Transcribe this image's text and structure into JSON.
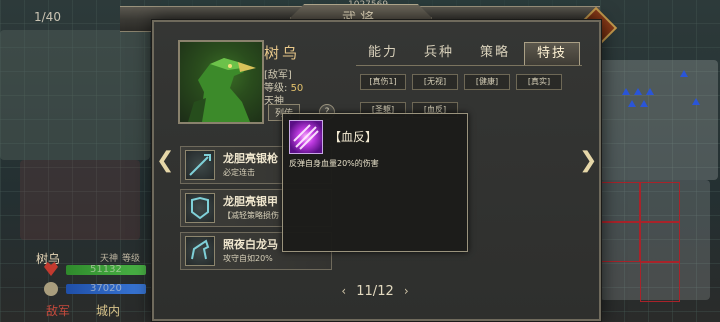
{
  "hud": {
    "page_counter": "1/40",
    "top_number": "1027569"
  },
  "map_general": {
    "name": "树乌",
    "type": "天神",
    "level_label": "等级",
    "hp_value": "51132",
    "hp_max": "/",
    "mp_value": "37020",
    "mp_max": "/",
    "faction": "敌军",
    "location": "城内"
  },
  "dialog": {
    "title": "武将",
    "close_label": "✕",
    "general": {
      "name": "树乌",
      "faction": "[敌军]",
      "level_label": "等级:",
      "level_value": "50",
      "type": "天神",
      "badge": "列传",
      "help": "?"
    },
    "tabs": [
      {
        "label": "能力"
      },
      {
        "label": "兵种"
      },
      {
        "label": "策略"
      },
      {
        "label": "特技"
      }
    ],
    "active_tab": "特技",
    "skills_row1": [
      "[真伤1]",
      "[无视]",
      "[健康]",
      "[真实]"
    ],
    "skills_row2": [
      "[圣躯]",
      "[血反]"
    ],
    "equipment": [
      {
        "name": "龙胆亮银枪",
        "desc": "必定连击",
        "icon": "spear-icon"
      },
      {
        "name": "龙胆亮银甲",
        "desc": "【减轻策略损伤",
        "icon": "armor-icon"
      },
      {
        "name": "照夜白龙马",
        "desc": "攻守自如20%",
        "icon": "horse-icon"
      }
    ],
    "pager": {
      "current": "11/12",
      "prev": "‹",
      "next": "›"
    },
    "nav_prev": "❮",
    "nav_next": "❯"
  },
  "tooltip": {
    "name": "【血反】",
    "desc": "反弹自身血量20%的伤害",
    "icon": "blood-reflect-icon"
  },
  "colors": {
    "accent_gold": "#e2c06b",
    "hp_bar": "#3da03a",
    "mp_bar": "#2a66c8"
  }
}
